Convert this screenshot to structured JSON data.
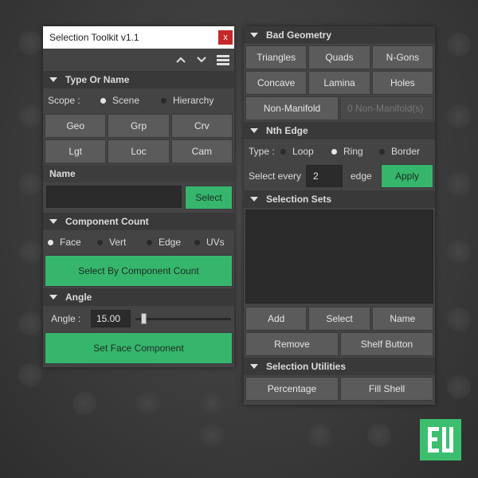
{
  "left_window": {
    "title": "Selection Toolkit v1.1",
    "close_label": "x",
    "toolbar": {
      "up_icon": "chevron-up",
      "down_icon": "chevron-down",
      "menu_icon": "menu"
    },
    "type_or_name": {
      "header": "Type Or Name",
      "scope_label": "Scope :",
      "scope_options": [
        "Scene",
        "Hierarchy"
      ],
      "scope_selected": "Scene",
      "type_buttons": [
        "Geo",
        "Grp",
        "Crv",
        "Lgt",
        "Loc",
        "Cam"
      ],
      "name_label": "Name",
      "name_value": "",
      "select_label": "Select"
    },
    "component_count": {
      "header": "Component Count",
      "options": [
        "Face",
        "Vert",
        "Edge",
        "UVs"
      ],
      "selected": "Face",
      "button_label": "Select By Component Count"
    },
    "angle": {
      "header": "Angle",
      "label": "Angle :",
      "value": "15.00",
      "slider_level": 0.06,
      "button_label": "Set Face Component"
    }
  },
  "right_window": {
    "bad_geometry": {
      "header": "Bad Geometry",
      "buttons": [
        "Triangles",
        "Quads",
        "N-Gons",
        "Concave",
        "Lamina",
        "Holes"
      ],
      "non_manifold_label": "Non-Manifold",
      "non_manifold_count": "0 Non-Manifold(s)"
    },
    "nth_edge": {
      "header": "Nth Edge",
      "type_label": "Type :",
      "type_options": [
        "Loop",
        "Ring",
        "Border"
      ],
      "type_selected": "Ring",
      "select_every_label": "Select every",
      "every_value": "2",
      "edge_label": "edge",
      "apply_label": "Apply"
    },
    "selection_sets": {
      "header": "Selection Sets",
      "buttons_row1": [
        "Add",
        "Select",
        "Name"
      ],
      "buttons_row2": [
        "Remove",
        "Shelf Button"
      ]
    },
    "selection_utilities": {
      "header": "Selection Utilities",
      "buttons": [
        "Percentage",
        "Fill Shell"
      ]
    }
  },
  "colors": {
    "accent_green": "#36b66d",
    "close_red": "#c62828",
    "panel": "#444444"
  }
}
